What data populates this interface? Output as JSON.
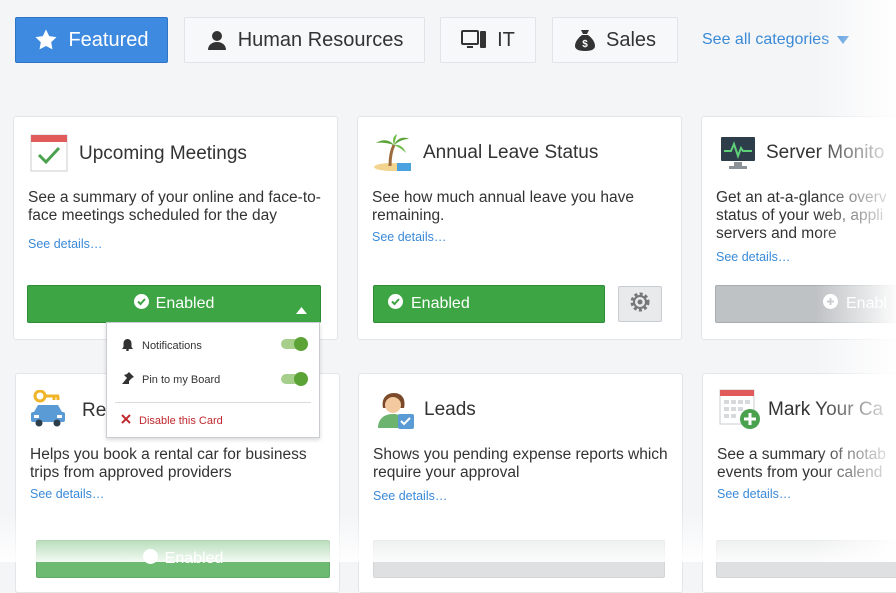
{
  "tabs": [
    {
      "label": "Featured",
      "icon": "star-icon",
      "active": true
    },
    {
      "label": "Human Resources",
      "icon": "person-icon",
      "active": false
    },
    {
      "label": "IT",
      "icon": "computer-icon",
      "active": false
    },
    {
      "label": "Sales",
      "icon": "money-bag-icon",
      "active": false
    }
  ],
  "see_all": "See all categories",
  "cards": [
    {
      "title": "Upcoming Meetings",
      "desc": "See a summary of your online and face-to-face meetings scheduled for the day",
      "link": "See details…",
      "button": "Enabled",
      "icon": "calendar-check-icon"
    },
    {
      "title": "Annual Leave Status",
      "desc": "See how much annual leave you have remaining.",
      "link": "See details…",
      "button": "Enabled",
      "icon": "palm-tree-icon"
    },
    {
      "title": "Server Monito",
      "desc": "Get an at-a-glance overv status of your web, appli servers and more",
      "link": "See details…",
      "button": "Enabl",
      "icon": "monitor-icon"
    },
    {
      "title": "Re",
      "desc": "Helps you book a rental car for business trips from approved providers",
      "link": "See details…",
      "button": "Enabled",
      "icon": "car-key-icon"
    },
    {
      "title": "Leads",
      "desc": "Shows you pending expense reports which require your approval",
      "link": "See details…",
      "icon": "person-check-icon"
    },
    {
      "title": "Mark Your Ca",
      "desc": "See a summary of notab events from your calend",
      "link": "See details…",
      "icon": "calendar-add-icon"
    }
  ],
  "dropdown": {
    "items": [
      {
        "label": "Notifications",
        "icon": "bell-icon",
        "toggle_on": true
      },
      {
        "label": "Pin to my Board",
        "icon": "pin-icon",
        "toggle_on": true
      }
    ],
    "disable": "Disable this Card"
  },
  "colors": {
    "accent": "#3d8ae0",
    "enabled": "#3da543",
    "link": "#3a8ad8",
    "danger": "#c0282d"
  }
}
